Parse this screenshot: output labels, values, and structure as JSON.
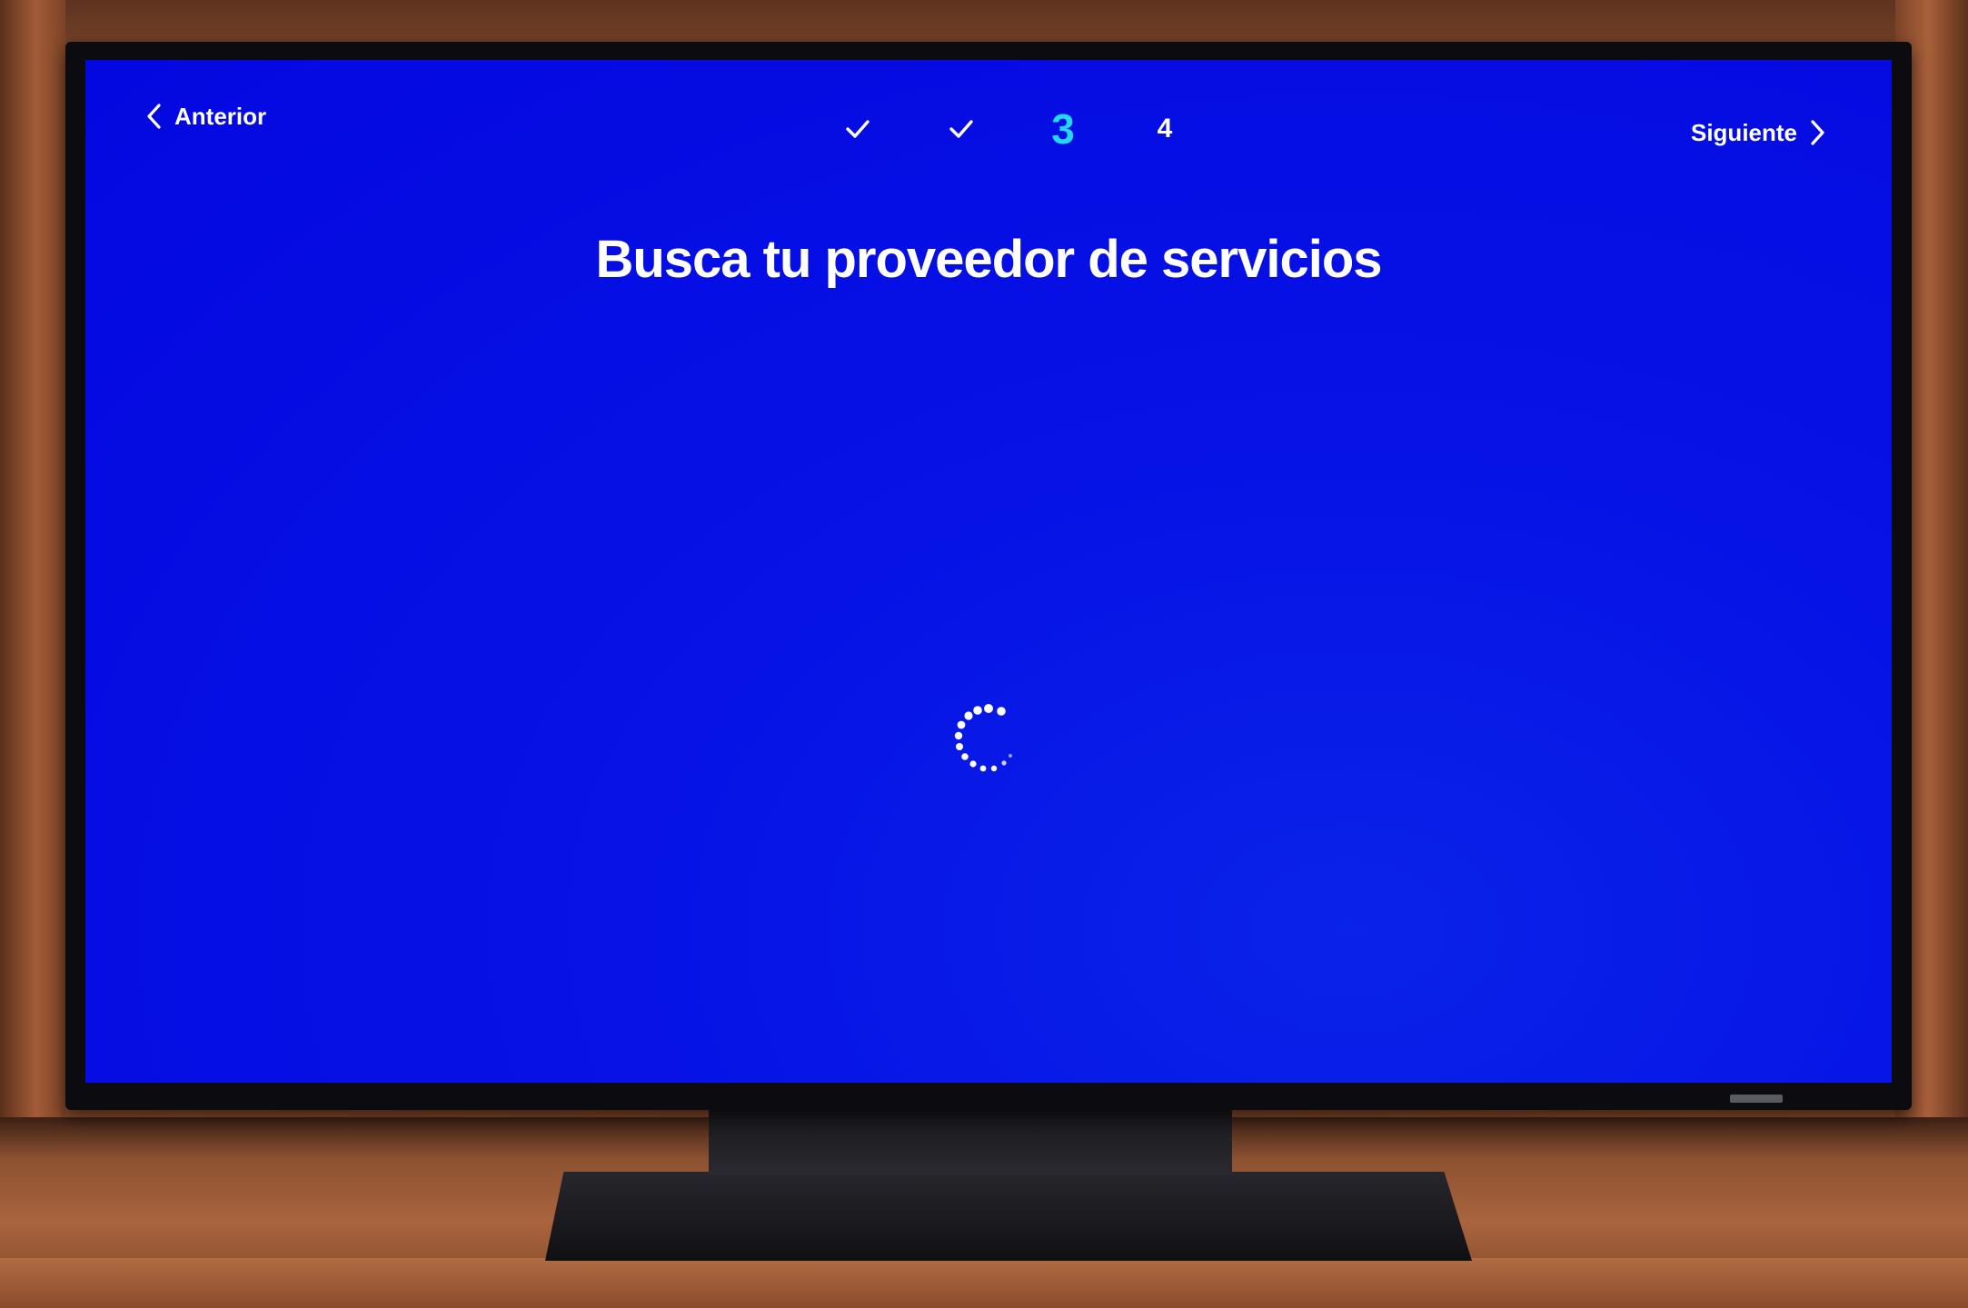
{
  "screen": {
    "background_color": "#0408e0",
    "accent_color": "#24d7f0",
    "nav": {
      "prev_label": "Anterior",
      "next_label": "Siguiente",
      "prev_icon": "chevron-left-icon",
      "next_icon": "chevron-right-icon"
    },
    "steps": [
      {
        "label": "✓",
        "state": "done",
        "icon": "check-icon"
      },
      {
        "label": "✓",
        "state": "done",
        "icon": "check-icon"
      },
      {
        "label": "3",
        "state": "active"
      },
      {
        "label": "4",
        "state": "pending"
      }
    ],
    "title": "Busca tu proveedor de servicios",
    "loading_icon": "loading-spinner-icon"
  }
}
